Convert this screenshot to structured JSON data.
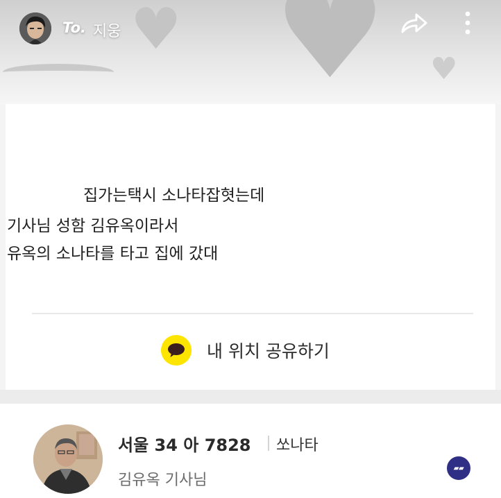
{
  "header": {
    "to_label": "To.",
    "recipient": "지웅"
  },
  "message": {
    "line1": "집가는택시 소나타잡혓는데",
    "line2": "기사님 성함 김유옥이라서",
    "line3": "유옥의 소나타를 타고 집에 갔대"
  },
  "share_location": {
    "label": "내 위치 공유하기"
  },
  "driver": {
    "plate": "서울 34 아 7828",
    "car_model": "쏘나타",
    "name": "김유옥 기사님"
  },
  "colors": {
    "kakao_yellow": "#fee500",
    "badge_navy": "#2f2f86"
  },
  "icons": [
    "share-arrow-icon",
    "more-vertical-icon",
    "kakao-talk-icon",
    "brand-badge-icon"
  ]
}
